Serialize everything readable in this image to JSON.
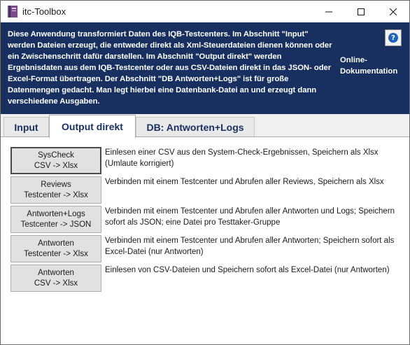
{
  "window": {
    "title": "itc-Toolbox",
    "icon": "app-book-icon",
    "controls": [
      "minimize-icon",
      "maximize-icon",
      "close-icon"
    ]
  },
  "header": {
    "description": "Diese Anwendung transformiert Daten des IQB-Testcenters. Im Abschnitt \"Input\" werden Dateien erzeugt, die entweder direkt als Xml-Steuerdateien dienen können oder ein Zwischenschritt dafür darstellen. Im Abschnitt \"Output direkt\" werden Ergebnisdaten aus dem IQB-Testcenter oder aus CSV-Dateien direkt in das JSON- oder Excel-Format übertragen. Der Abschnitt \"DB Antworten+Logs\" ist für große Datenmengen gedacht. Man legt hierbei eine Datenbank-Datei an und erzeugt dann verschiedene Ausgaben.",
    "help_glyph": "?",
    "doc_link_label": "Online-Dokumentation"
  },
  "tabs": [
    {
      "label": "Input",
      "active": false
    },
    {
      "label": "Output direkt",
      "active": true
    },
    {
      "label": "DB: Antworten+Logs",
      "active": false
    }
  ],
  "actions": [
    {
      "line1": "SysCheck",
      "line2": "CSV -> Xlsx",
      "description": "Einlesen einer CSV aus den System-Check-Ergebnissen, Speichern als Xlsx (Umlaute korrigiert)"
    },
    {
      "line1": "Reviews",
      "line2": "Testcenter -> Xlsx",
      "description": "Verbinden mit einem Testcenter und Abrufen aller Reviews, Speichern als Xlsx"
    },
    {
      "line1": "Antworten+Logs",
      "line2": "Testcenter -> JSON",
      "description": "Verbinden mit einem Testcenter und Abrufen aller Antworten und Logs; Speichern sofort als JSON; eine Datei pro Testtaker-Gruppe"
    },
    {
      "line1": "Antworten",
      "line2": "Testcenter -> Xlsx",
      "description": "Verbinden mit einem Testcenter und Abrufen aller Antworten; Speichern sofort als Excel-Datei (nur Antworten)"
    },
    {
      "line1": "Antworten",
      "line2": "CSV -> Xlsx",
      "description": "Einlesen von CSV-Dateien und Speichern sofort als Excel-Datei (nur Antworten)"
    }
  ],
  "colors": {
    "header_bg": "#17305f",
    "tab_text": "#17305f",
    "button_bg": "#e1e1e1",
    "help_icon": "#1f63b8"
  }
}
